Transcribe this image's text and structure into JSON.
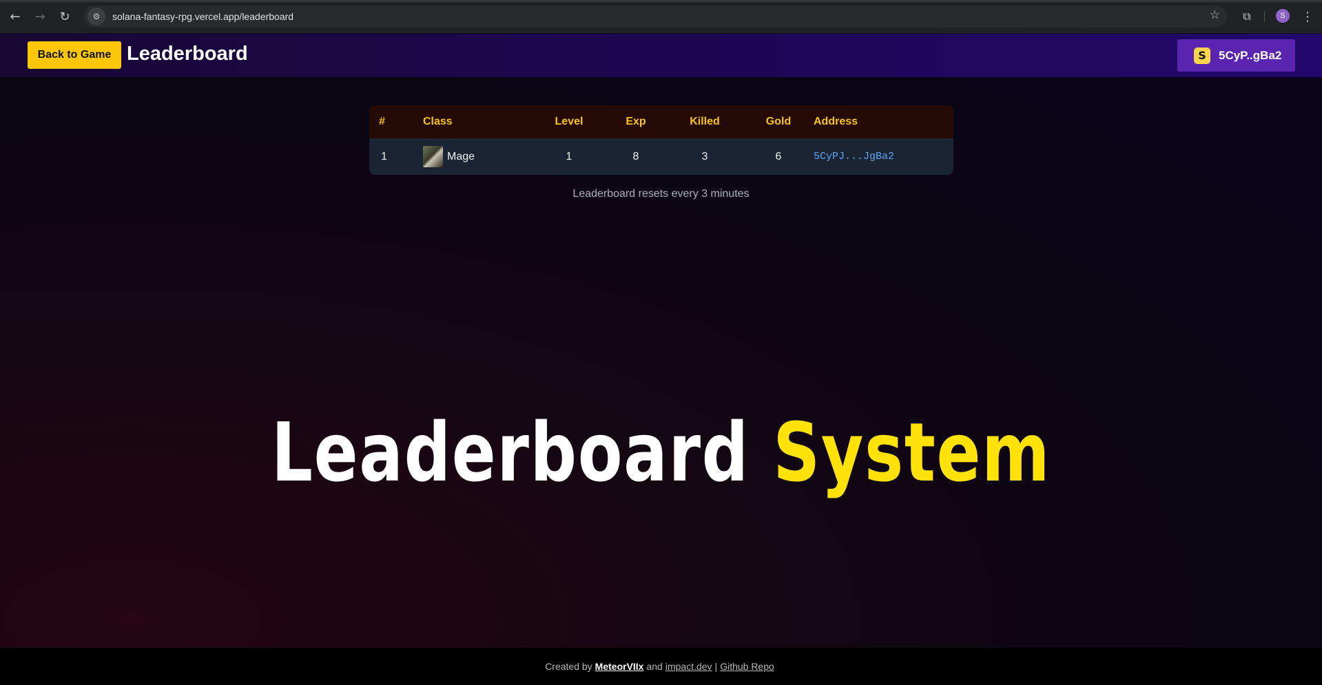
{
  "browser": {
    "url": "solana-fantasy-rpg.vercel.app/leaderboard",
    "profile_initial": "S"
  },
  "header": {
    "back_label": "Back to Game",
    "title": "Leaderboard",
    "wallet_label": "5CyP..gBa2"
  },
  "table": {
    "columns": [
      "#",
      "Class",
      "Level",
      "Exp",
      "Killed",
      "Gold",
      "Address"
    ],
    "rows": [
      {
        "rank": "1",
        "class": "Mage",
        "level": "1",
        "exp": "8",
        "killed": "3",
        "gold": "6",
        "address": "5CyPJ...JgBa2"
      }
    ]
  },
  "reset_note": "Leaderboard resets every 3 minutes",
  "hero": {
    "word1": "Leaderboard",
    "word2": "System"
  },
  "footer": {
    "created_by": "Created by",
    "author": "MeteorVIIx",
    "and": "and",
    "partner": "impact.dev",
    "separator": "|",
    "repo": "Github Repo"
  },
  "colors": {
    "accent_yellow": "#fcc70a",
    "wallet_purple": "#5b24b0",
    "address_blue": "#59a7f5"
  },
  "icons": [
    "back-icon",
    "forward-icon",
    "reload-icon",
    "site-info-icon",
    "star-icon",
    "extensions-icon",
    "menu-icon",
    "wallet-icon"
  ]
}
